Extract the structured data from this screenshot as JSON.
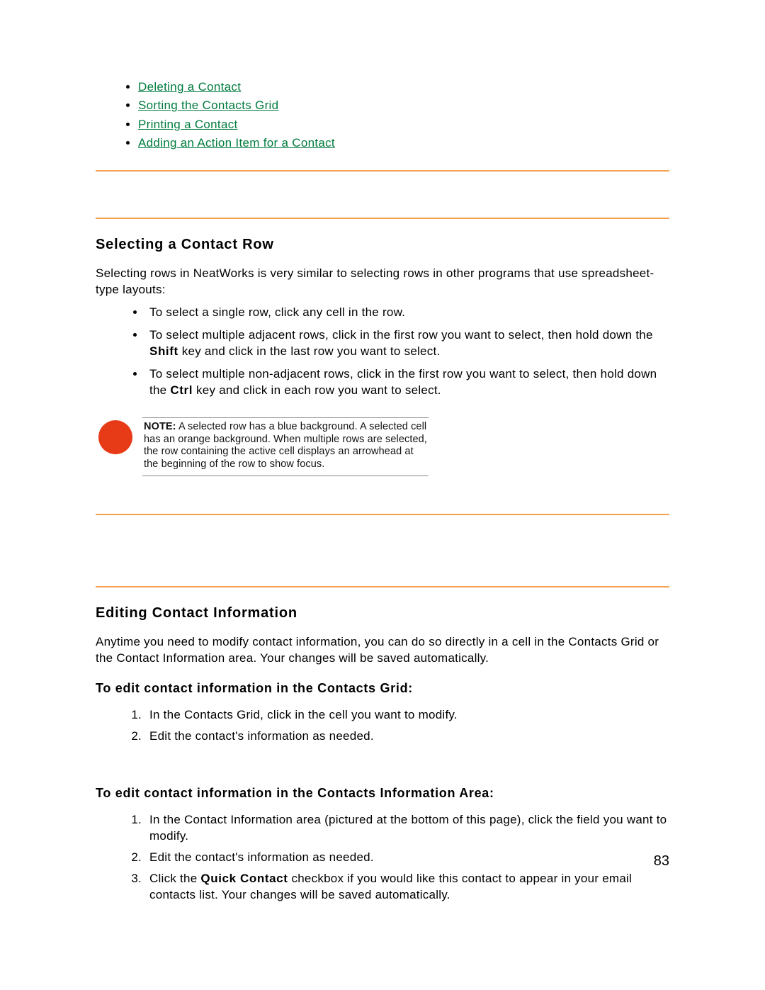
{
  "topLinks": [
    "Deleting a Contact",
    "Sorting the Contacts Grid",
    "Printing a Contact",
    "Adding an Action Item for a Contact"
  ],
  "section1": {
    "heading": "Selecting a Contact Row",
    "intro": "Selecting rows in NeatWorks is very similar to selecting rows in other programs that use spreadsheet-type layouts:",
    "bullets": [
      {
        "text": "To select a single row, click any cell in the row."
      },
      {
        "pre": "To select multiple adjacent rows, click in the first row you want to select, then hold down the ",
        "bold": "Shift",
        "post": " key and click in the last row you want to select."
      },
      {
        "pre": "To select multiple non-adjacent rows, click in the first row you want to select, then hold down the ",
        "bold": "Ctrl",
        "post": " key and click in each row you want to select."
      }
    ],
    "noteLabel": "NOTE:",
    "noteText": " A selected row has a blue background. A selected cell has an orange background. When multiple rows are selected, the row containing the active cell displays an arrowhead at the beginning of the row to show focus."
  },
  "section2": {
    "heading": "Editing Contact Information",
    "intro": "Anytime you need to modify contact information, you can do so directly in a cell in the Contacts Grid or the Contact Information area. Your changes will be saved automatically.",
    "sub1": {
      "heading": "To edit contact information in the Contacts Grid:",
      "items": [
        "In the Contacts Grid, click in the cell you want to modify.",
        "Edit the contact's information as needed."
      ]
    },
    "sub2": {
      "heading": "To edit contact information in the Contacts Information Area:",
      "items": [
        {
          "text": "In the Contact Information area (pictured at the bottom of this page), click the field you want to modify."
        },
        {
          "text": "Edit the contact's information as needed."
        },
        {
          "pre": "Click the ",
          "bold": "Quick Contact",
          "post": " checkbox if you would like this contact to appear in your email contacts list. Your changes will be saved automatically."
        }
      ]
    }
  },
  "pageNumber": "83"
}
